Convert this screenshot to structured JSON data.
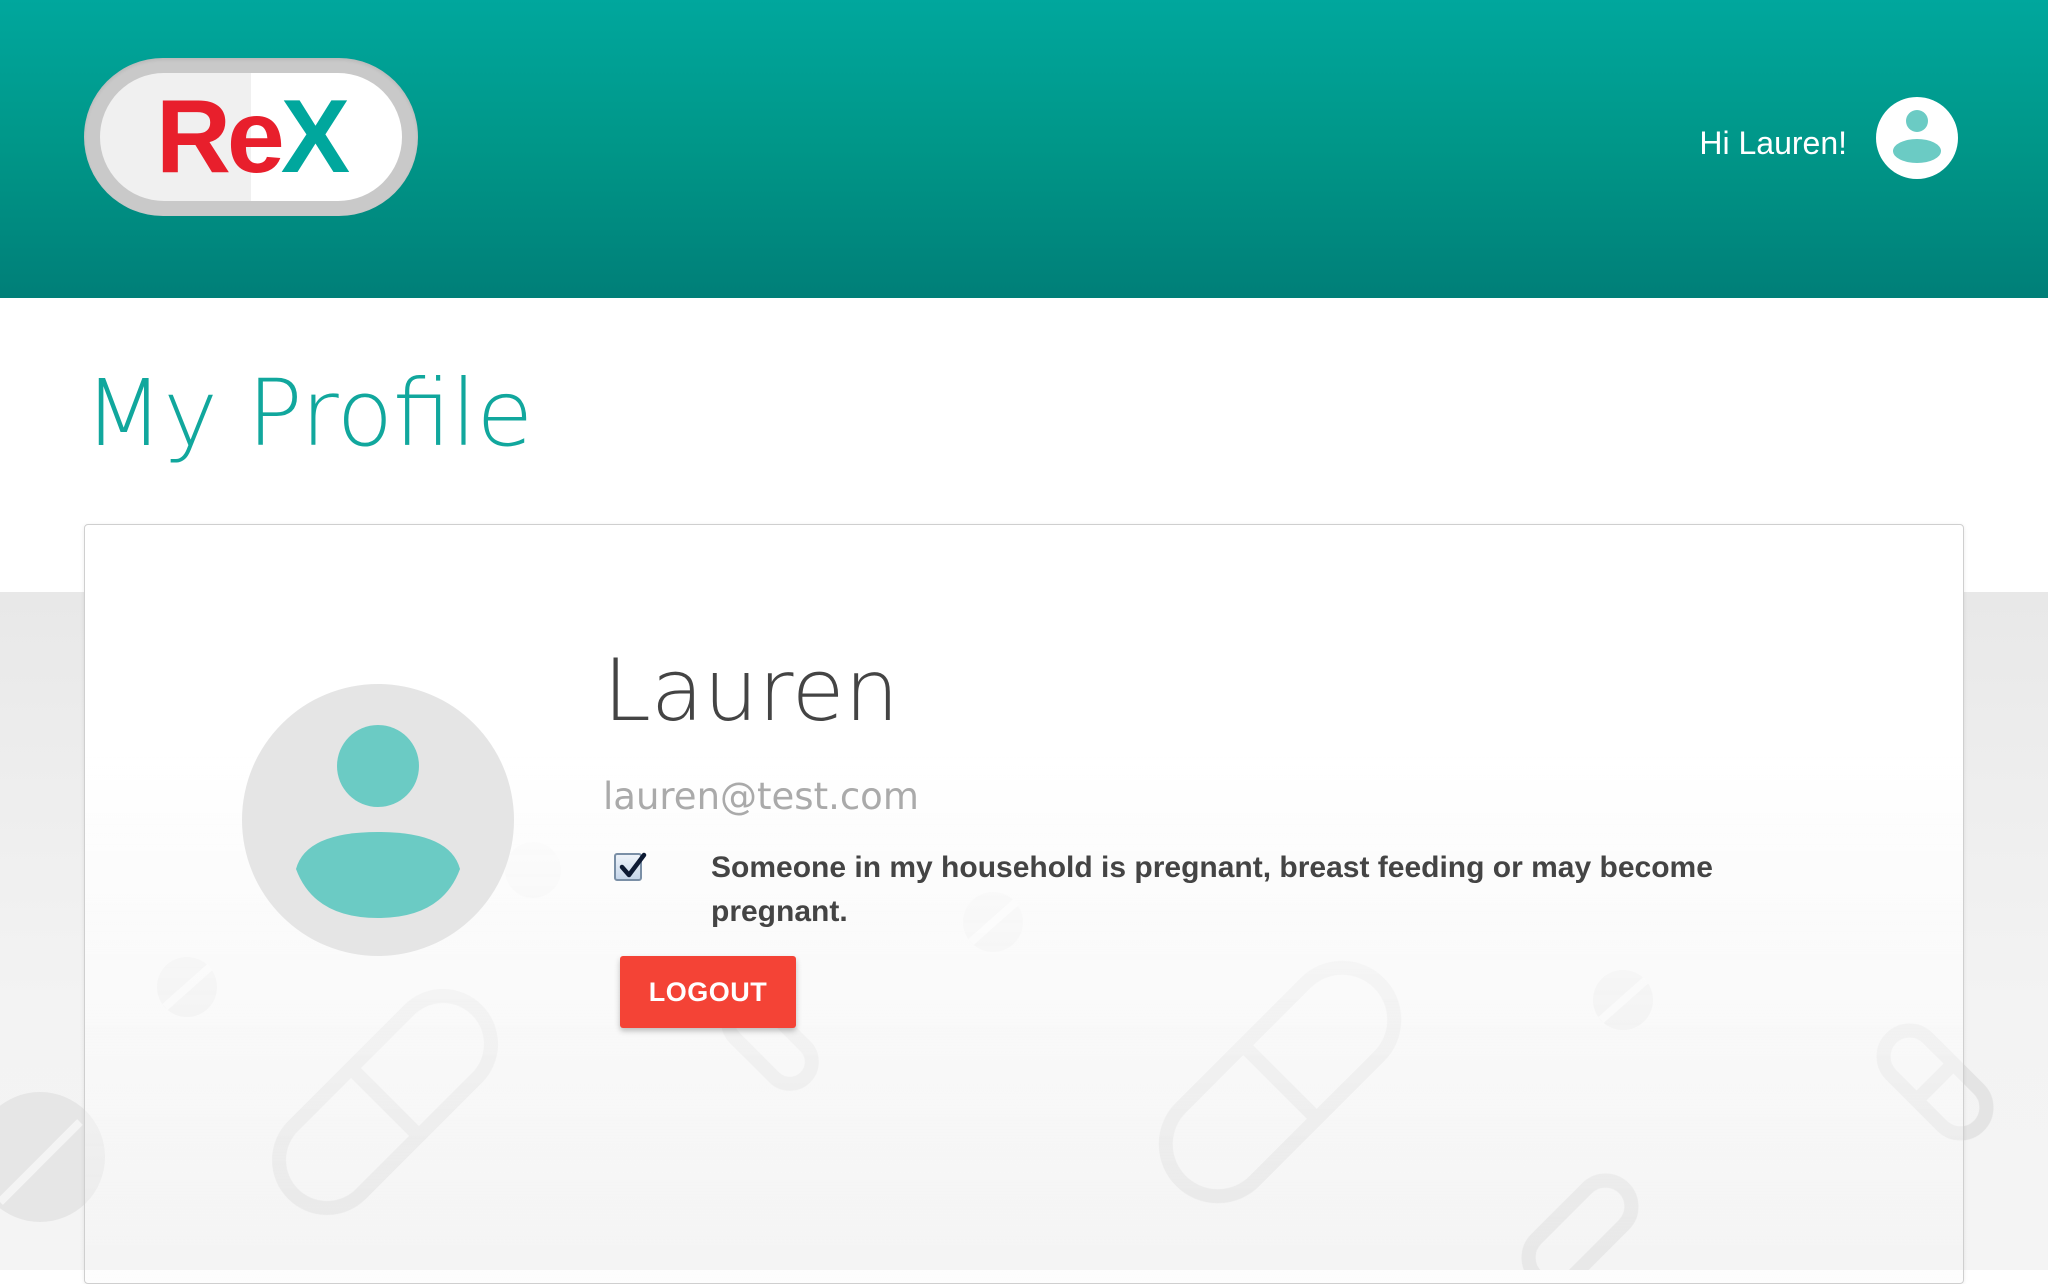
{
  "header": {
    "logo": {
      "re": "Re",
      "x": "X"
    },
    "greeting": "Hi Lauren!",
    "avatar_icon": "user-avatar-icon"
  },
  "page": {
    "title": "My Profile"
  },
  "profile": {
    "name": "Lauren",
    "email": "lauren@test.com",
    "avatar_icon": "user-avatar-icon",
    "pregnancy_checkbox": {
      "checked": true,
      "label": "Someone in my household is pregnant, breast feeding or may become pregnant."
    },
    "logout_label": "LOGOUT"
  },
  "colors": {
    "header": "#009688",
    "accent": "#11a79d",
    "avatar_figure": "#6bcbc4",
    "logout": "#f44336",
    "logo_red": "#e81f2c",
    "logo_teal": "#00a79d"
  }
}
